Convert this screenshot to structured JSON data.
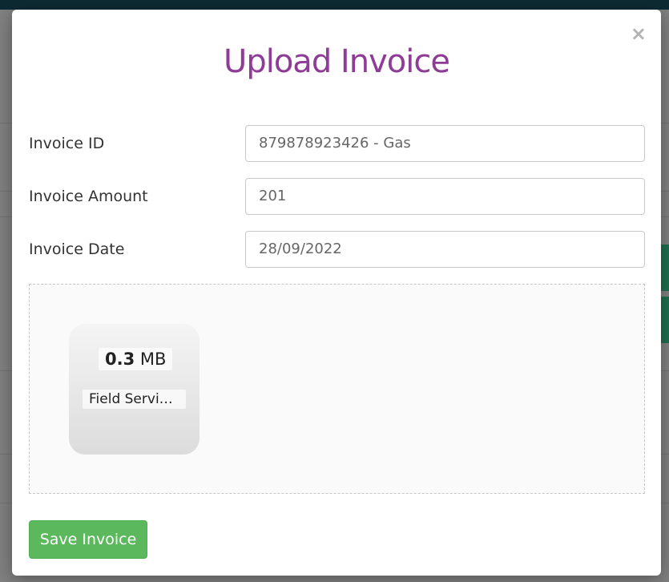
{
  "modal": {
    "title": "Upload Invoice",
    "close_icon": "times-icon",
    "close_glyph": "×"
  },
  "form": {
    "invoice_id": {
      "label": "Invoice ID",
      "value": "879878923426 - Gas"
    },
    "invoice_amount": {
      "label": "Invoice Amount",
      "value": "201"
    },
    "invoice_date": {
      "label": "Invoice Date",
      "value": "28/09/2022"
    }
  },
  "upload": {
    "file_size_value": "0.3",
    "file_size_unit": "MB",
    "file_name": "Field Service..."
  },
  "actions": {
    "save_label": "Save Invoice"
  },
  "colors": {
    "title": "#8e3c96",
    "save_button": "#5cb85c",
    "overlay": "#808080"
  }
}
